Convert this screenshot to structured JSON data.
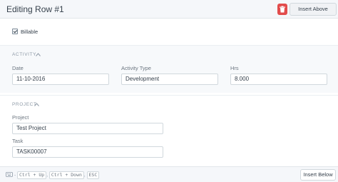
{
  "header": {
    "title": "Editing Row #1",
    "delete_icon": "trash-icon",
    "insert_above_label": "Insert Above"
  },
  "billable": {
    "label": "Billable",
    "checked": true
  },
  "activity_section": {
    "title": "ACTIVITY",
    "fields": {
      "date": {
        "label": "Date",
        "value": "11-10-2016"
      },
      "activity_type": {
        "label": "Activity Type",
        "value": "Development"
      },
      "hrs": {
        "label": "Hrs",
        "value": "8.000"
      }
    }
  },
  "project_section": {
    "title": "PROJECT",
    "fields": {
      "project": {
        "label": "Project",
        "value": "Test Project"
      },
      "task": {
        "label": "Task",
        "value": "TASK00007"
      }
    }
  },
  "footer": {
    "keyboard_icon": "keyboard-icon",
    "separator": "-",
    "shortcuts": [
      "Ctrl + Up",
      "Ctrl + Down",
      "ESC"
    ],
    "insert_below_label": "Insert Below"
  },
  "colors": {
    "delete": "#e24c4c",
    "header_bg": "#f5f7fa",
    "section_bg": "#f7f9fb"
  }
}
